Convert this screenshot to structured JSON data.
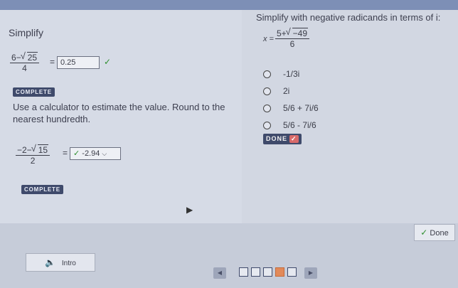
{
  "left": {
    "title": "Simplify",
    "problem1": {
      "numerator_pre": "6−",
      "radicand": "25",
      "denominator": "4",
      "equals": "=",
      "answer": "0.25",
      "check": "✓"
    },
    "badge1": "COMPLETE",
    "prompt2": "Use a calculator to estimate the value.  Round to the nearest hundredth.",
    "problem2": {
      "numerator_pre": "−2−",
      "radicand": "15",
      "denominator": "2",
      "equals": "=",
      "answer": "-2.94"
    },
    "badge2": "COMPLETE"
  },
  "right": {
    "title": "Simplify with negative radicands in terms of i:",
    "expr": {
      "var": "x =",
      "numerator_pre": "5+",
      "radicand": "−49",
      "denominator": "6"
    },
    "options": [
      "-1/3i",
      "2i",
      "5/6 + 7i/6",
      "5/6 - 7i/6"
    ],
    "done_badge": "DONE"
  },
  "footer": {
    "done_label": "Done",
    "intro_label": "Intro",
    "prev": "◀",
    "next": "▶",
    "pages": 5,
    "active_page": 4
  },
  "colors": {
    "badge": "#3f4a6b",
    "accent": "#e28a5a",
    "check_green": "#2f8f2f"
  }
}
